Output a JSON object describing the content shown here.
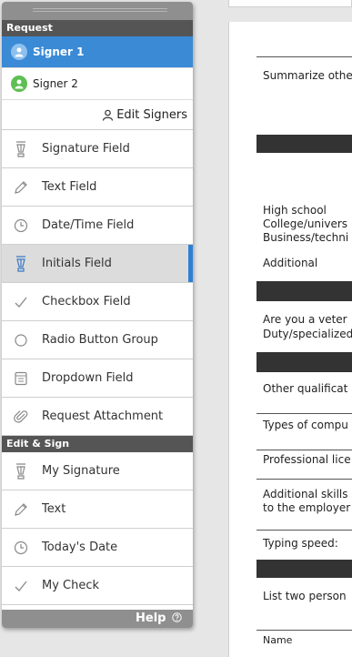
{
  "panel": {
    "request_heading": "Request",
    "signers": [
      {
        "label": "Signer 1",
        "color": "#3a8ad6"
      },
      {
        "label": "Signer 2",
        "color": "#5fbf53"
      }
    ],
    "edit_signers": "Edit Signers",
    "request_items": [
      {
        "label": "Signature Field",
        "icon": "pen-nib-icon"
      },
      {
        "label": "Text Field",
        "icon": "pencil-icon"
      },
      {
        "label": "Date/Time Field",
        "icon": "clock-icon"
      },
      {
        "label": "Initials Field",
        "icon": "pen-nib-icon",
        "selected": true
      },
      {
        "label": "Checkbox Field",
        "icon": "check-icon"
      },
      {
        "label": "Radio Button Group",
        "icon": "radio-icon"
      },
      {
        "label": "Dropdown Field",
        "icon": "list-icon"
      },
      {
        "label": "Request Attachment",
        "icon": "paperclip-icon"
      }
    ],
    "edit_sign_heading": "Edit & Sign",
    "edit_items": [
      {
        "label": "My Signature",
        "icon": "pen-nib-icon"
      },
      {
        "label": "Text",
        "icon": "pencil-icon"
      },
      {
        "label": "Today's Date",
        "icon": "clock-icon"
      },
      {
        "label": "My Check",
        "icon": "check-icon"
      }
    ],
    "help": "Help"
  },
  "document": {
    "lines": [
      "Summarize othe",
      "High school",
      "College/univers",
      "Business/techni",
      "Additional",
      "Are you a veter",
      "Duty/specialized",
      "Other qualificat",
      "Types of compu",
      "Professional lice",
      "Additional skills",
      "to the employer",
      "Typing speed:",
      "List two person",
      "Name"
    ]
  }
}
